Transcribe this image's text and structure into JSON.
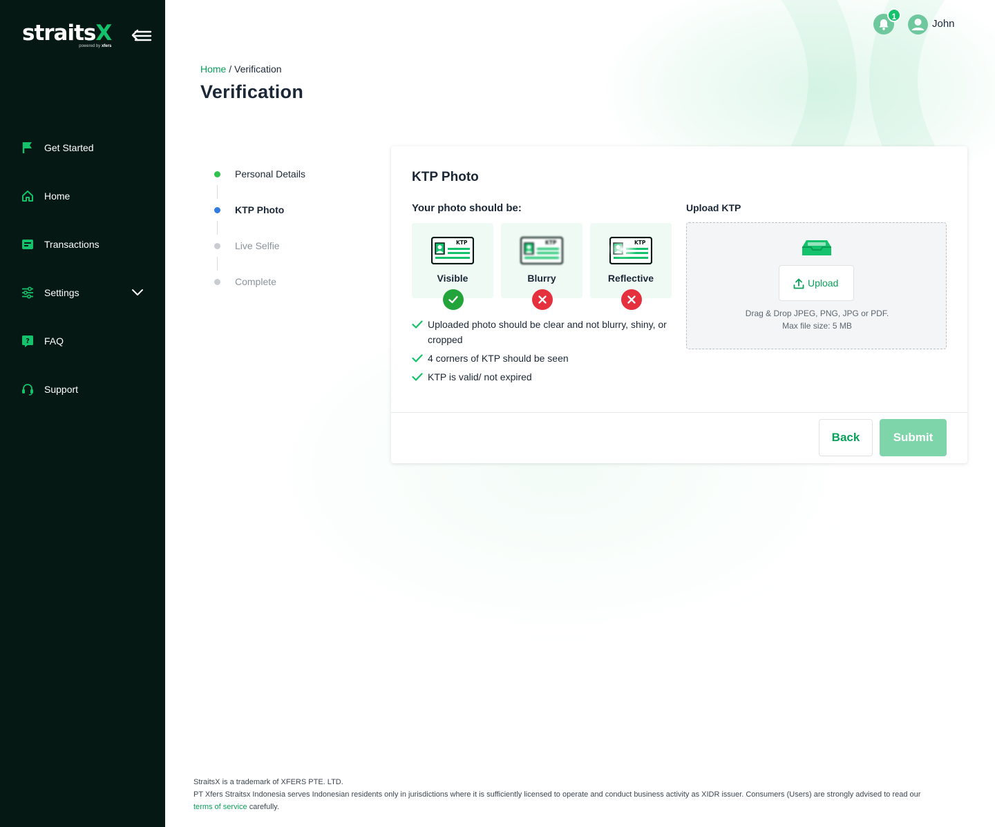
{
  "brand": {
    "logo_main": "straits",
    "logo_x": "X",
    "logo_sub_prefix": "powered by ",
    "logo_sub_brand": "xfers"
  },
  "colors": {
    "sidebar_bg": "#061814",
    "accent": "#13c26a",
    "link": "#0aa05a",
    "error": "#e5313d",
    "step_active": "#2f7de1",
    "submit_disabled": "#7ed5aa"
  },
  "sidebar": {
    "items": [
      {
        "label": "Get Started",
        "icon": "flag-icon"
      },
      {
        "label": "Home",
        "icon": "house-icon"
      },
      {
        "label": "Transactions",
        "icon": "wallet-icon"
      },
      {
        "label": "Settings",
        "icon": "sliders-icon",
        "expandable": true
      },
      {
        "label": "FAQ",
        "icon": "question-icon"
      },
      {
        "label": "Support",
        "icon": "headset-icon"
      }
    ]
  },
  "header": {
    "notification_count": "1",
    "username": "John"
  },
  "breadcrumb": {
    "home": "Home",
    "separator": "/",
    "current": "Verification"
  },
  "page_title": "Verification",
  "stepper": {
    "steps": [
      {
        "label": "Personal Details",
        "state": "done"
      },
      {
        "label": "KTP Photo",
        "state": "active"
      },
      {
        "label": "Live Selfie",
        "state": "pending"
      },
      {
        "label": "Complete",
        "state": "pending"
      }
    ]
  },
  "card": {
    "title": "KTP Photo",
    "guidelines_title": "Your photo should be:",
    "ktp_card_label": "KTP",
    "examples": [
      {
        "label": "Visible",
        "status": "ok"
      },
      {
        "label": "Blurry",
        "status": "bad"
      },
      {
        "label": "Reflective",
        "status": "bad"
      }
    ],
    "requirements": [
      "Uploaded photo should be clear and not blurry, shiny, or cropped",
      "4 corners of KTP should be seen",
      "KTP is valid/ not expired"
    ],
    "upload": {
      "title": "Upload KTP",
      "button": "Upload",
      "hint_formats": "Drag & Drop JPEG, PNG, JPG or PDF.",
      "hint_size": "Max file size: 5 MB"
    },
    "back_button": "Back",
    "submit_button": "Submit"
  },
  "footer": {
    "line1": "StraitsX is a trademark of XFERS PTE. LTD.",
    "line2": "PT Xfers Straitsx Indonesia serves Indonesian residents only in jurisdictions where it is sufficiently licensed to operate and conduct business activity as XIDR issuer. Consumers (Users) are strongly advised to read our",
    "tos_link": "terms of service",
    "line3_tail": " carefully."
  }
}
